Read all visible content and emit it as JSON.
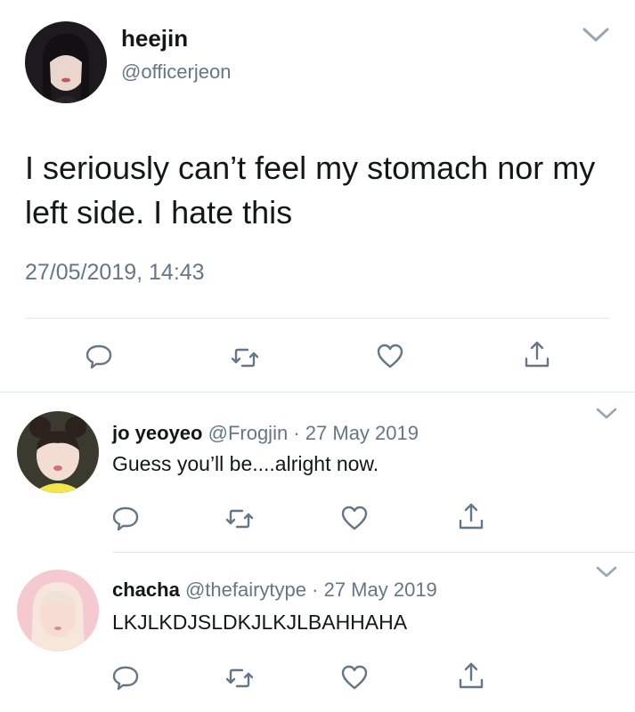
{
  "tweet": {
    "author_name": "heejin",
    "author_handle": "@officerjeon",
    "text": "I seriously can’t feel my stomach nor my left side. I hate this",
    "timestamp": "27/05/2019, 14:43"
  },
  "replies": [
    {
      "author_name": "jo yeoyeo",
      "author_handle": "@Frogjin",
      "separator": "·",
      "date": "27 May 2019",
      "text": "Guess you’ll be....alright now."
    },
    {
      "author_name": "chacha",
      "author_handle": "@thefairytype",
      "separator": "·",
      "date": "27 May 2019",
      "text": "LKJLKDJSLDKJLKJLBAHHAHA"
    }
  ],
  "icons": {
    "reply": "speech-bubble-icon",
    "retweet": "retweet-icon",
    "like": "heart-icon",
    "share": "share-icon",
    "more": "chevron-down-icon"
  },
  "colors": {
    "text": "#14171a",
    "secondary": "#657786",
    "icon": "#657786",
    "divider": "#e1e8ed"
  }
}
